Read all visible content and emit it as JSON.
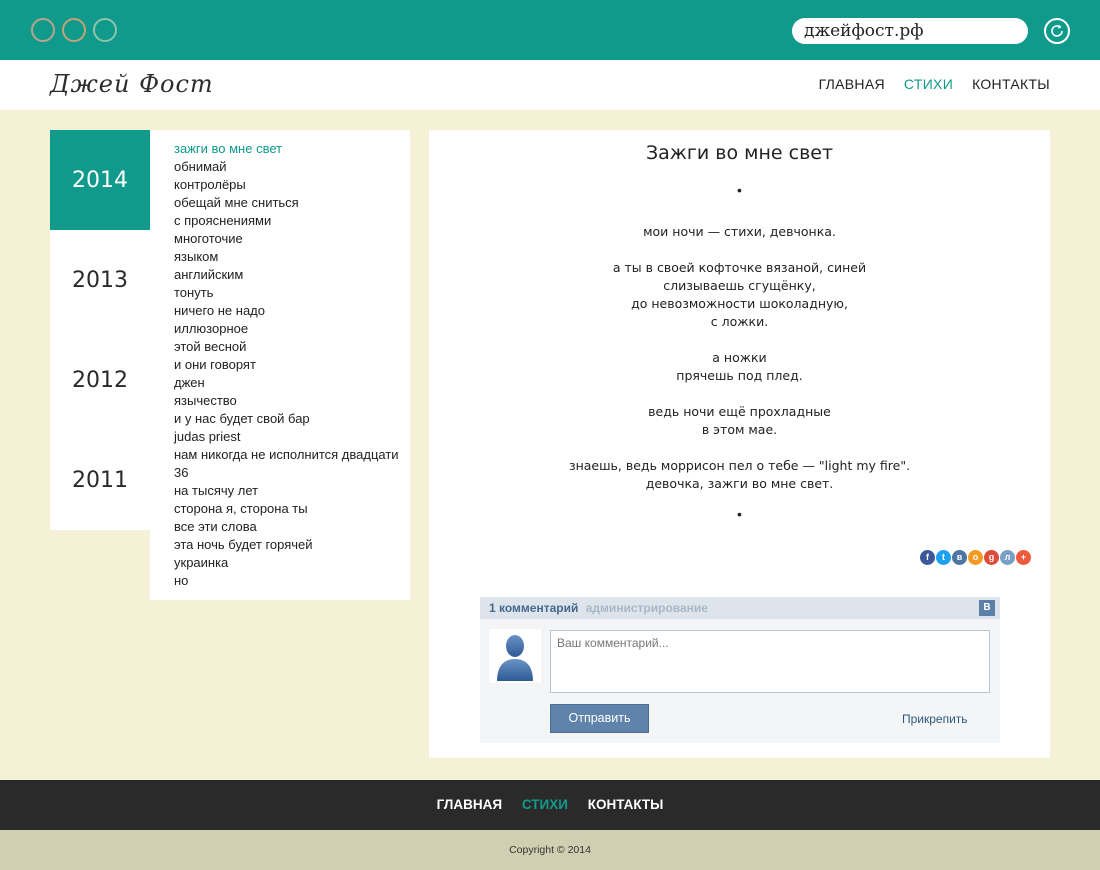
{
  "browser": {
    "url": "джейфост.рф",
    "colors": {
      "bar": "#0f9a8b"
    }
  },
  "header": {
    "logo": "Джей Фост",
    "nav": [
      {
        "label": "ГЛАВНАЯ",
        "active": false
      },
      {
        "label": "СТИХИ",
        "active": true
      },
      {
        "label": "КОНТАКТЫ",
        "active": false
      }
    ]
  },
  "sidebar": {
    "years": [
      {
        "label": "2014",
        "active": true
      },
      {
        "label": "2013",
        "active": false
      },
      {
        "label": "2012",
        "active": false
      },
      {
        "label": "2011",
        "active": false
      }
    ],
    "poems": [
      "зажги во мне свет",
      "обнимай",
      "контролёры",
      "обещай мне сниться",
      "с прояснениями",
      "многоточие",
      "языком",
      "английским",
      "тонуть",
      "ничего не надо",
      "иллюзорное",
      "этой весной",
      "и они говорят",
      "джен",
      "язычество",
      "и у нас будет свой бар",
      "judas priest",
      "нам никогда не исполнится двадцати",
      "36",
      "на тысячу лет",
      "сторона я, сторона ты",
      "все эти слова",
      "эта ночь будет горячей",
      "украинка",
      "но"
    ],
    "active_poem": 0
  },
  "poem": {
    "title": "Зажги во мне свет",
    "separator": "•",
    "stanzas": [
      [
        "мои ночи — стихи, девчонка."
      ],
      [
        "а ты в своей кофточке вязаной, синей",
        "слизываешь сгущёнку,",
        "до невозможности шоколадную,",
        "с ложки."
      ],
      [
        "а ножки",
        "прячешь под плед."
      ],
      [
        "ведь ночи ещё прохладные",
        "в этом мае."
      ],
      [
        "знаешь, ведь моррисон пел о тебе — \"light my fire\".",
        "девочка, зажги во мне свет."
      ]
    ]
  },
  "share": [
    {
      "icon": "facebook-icon",
      "glyph": "f",
      "color": "#3b5998"
    },
    {
      "icon": "twitter-icon",
      "glyph": "t",
      "color": "#1da1f2"
    },
    {
      "icon": "vk-icon",
      "glyph": "в",
      "color": "#4c75a3"
    },
    {
      "icon": "odnoklassniki-icon",
      "glyph": "о",
      "color": "#f59a23"
    },
    {
      "icon": "googleplus-icon",
      "glyph": "g",
      "color": "#dd4b39"
    },
    {
      "icon": "livejournal-icon",
      "glyph": "л",
      "color": "#7a9fc4"
    },
    {
      "icon": "more-icon",
      "glyph": "+",
      "color": "#ee5a3c"
    }
  ],
  "comments": {
    "count_label": "1 комментарий",
    "admin_label": "администрирование",
    "vk_badge": "В",
    "placeholder": "Ваш комментарий...",
    "send_label": "Отправить",
    "attach_label": "Прикрепить"
  },
  "footer": {
    "nav": [
      {
        "label": "ГЛАВНАЯ",
        "active": false
      },
      {
        "label": "СТИХИ",
        "active": true
      },
      {
        "label": "КОНТАКТЫ",
        "active": false
      }
    ],
    "copyright": "Copyright © 2014"
  }
}
